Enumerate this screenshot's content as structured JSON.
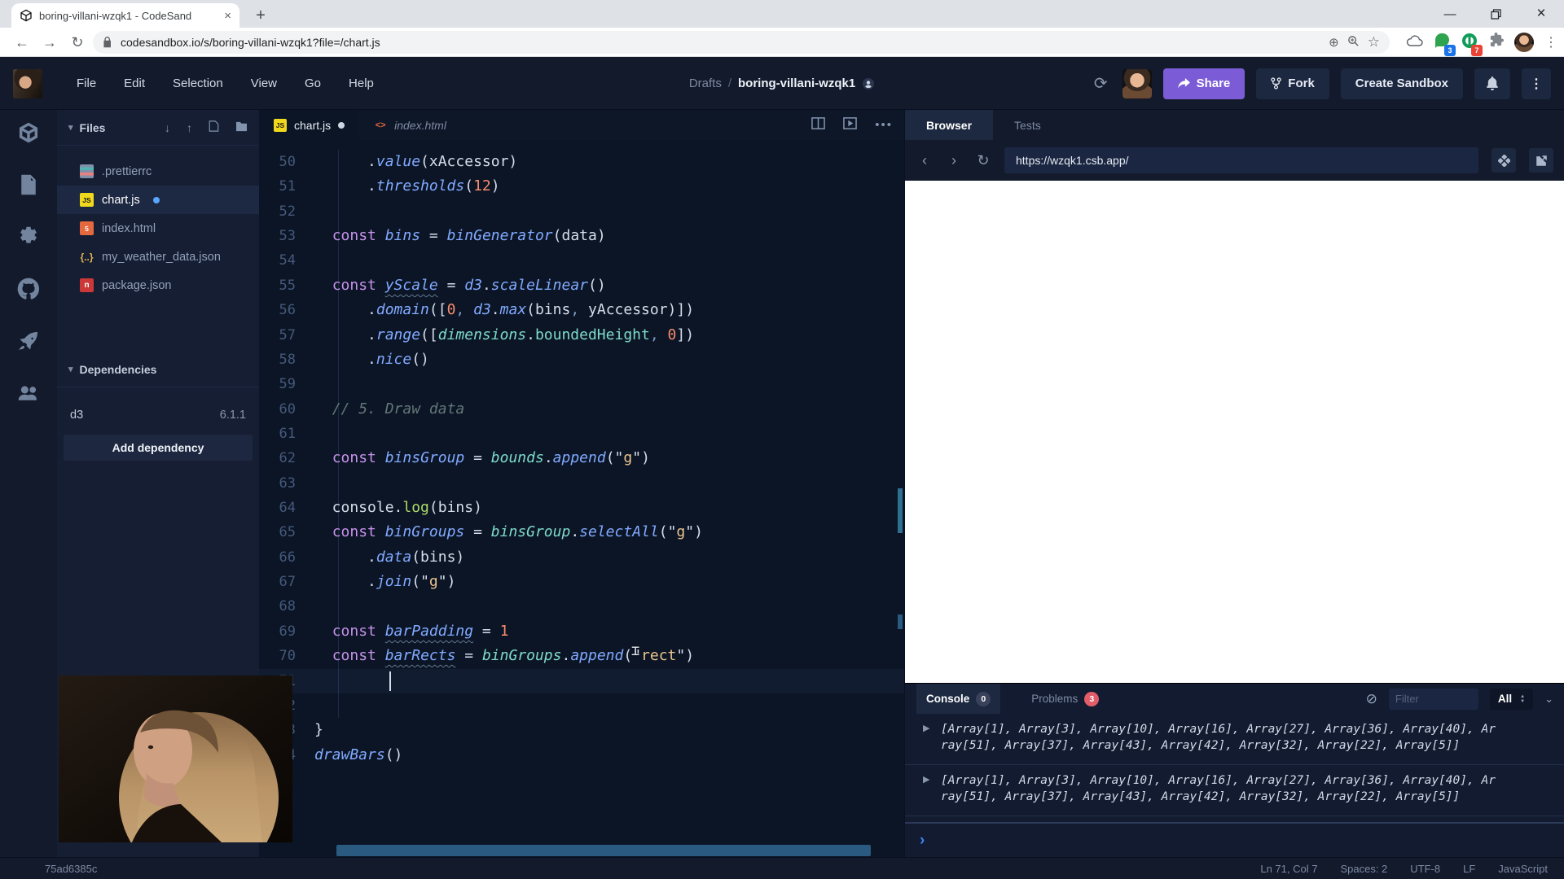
{
  "browser_chrome": {
    "tab_title": "boring-villani-wzqk1 - CodeSand",
    "close_tab_glyph": "×",
    "new_tab_glyph": "+",
    "back_glyph": "←",
    "forward_glyph": "→",
    "reload_glyph": "↻",
    "url": "codesandbox.io/s/boring-villani-wzqk1?file=/chart.js",
    "zoom_glyph": "⊕",
    "bookmark_glyph": "☆",
    "extension_chat_badge": "3",
    "extension_ring_badge": "7",
    "kebab_glyph": "⋮",
    "minimize_glyph": "—",
    "close_glyph": "×"
  },
  "header": {
    "menus": [
      "File",
      "Edit",
      "Selection",
      "View",
      "Go",
      "Help"
    ],
    "breadcrumb_prefix": "Drafts",
    "breadcrumb_sep": "/",
    "title": "boring-villani-wzqk1",
    "refresh_glyph": "⟳",
    "share_label": "Share",
    "fork_label": "Fork",
    "create_sandbox_label": "Create Sandbox",
    "accent_purple": "#7b5cd6"
  },
  "sidebar": {
    "files_header": "Files",
    "download_glyph": "↓",
    "upload_glyph": "↑",
    "files": [
      {
        "name": ".prettierrc",
        "icon": "prettier",
        "icon_text": "",
        "active": false,
        "modified": false
      },
      {
        "name": "chart.js",
        "icon": "js",
        "icon_text": "JS",
        "active": true,
        "modified": true
      },
      {
        "name": "index.html",
        "icon": "html",
        "icon_text": "5",
        "active": false,
        "modified": false
      },
      {
        "name": "my_weather_data.json",
        "icon": "json",
        "icon_text": "{..}",
        "active": false,
        "modified": false
      },
      {
        "name": "package.json",
        "icon": "npm",
        "icon_text": "n",
        "active": false,
        "modified": false
      }
    ],
    "dependencies_header": "Dependencies",
    "dependencies": [
      {
        "name": "d3",
        "version": "6.1.1"
      }
    ],
    "add_dependency_label": "Add dependency"
  },
  "editor": {
    "tabs": [
      {
        "label": "chart.js",
        "icon": "js",
        "icon_text": "JS",
        "active": true,
        "modified": true,
        "preview": false
      },
      {
        "label": "index.html",
        "icon": "html",
        "icon_text": "<>",
        "active": false,
        "modified": false,
        "preview": true
      }
    ],
    "cursor": {
      "line": 71,
      "col": 7
    },
    "first_line": 50,
    "lines": [
      {
        "n": 50,
        "tokens": [
          {
            "x": "      .",
            "c": "p"
          },
          {
            "x": "value",
            "c": "v"
          },
          {
            "x": "(xAccessor)",
            "c": "p"
          }
        ]
      },
      {
        "n": 51,
        "tokens": [
          {
            "x": "      .",
            "c": "p"
          },
          {
            "x": "thresholds",
            "c": "v"
          },
          {
            "x": "(",
            "c": "p"
          },
          {
            "x": "12",
            "c": "n"
          },
          {
            "x": ")",
            "c": "p"
          }
        ]
      },
      {
        "n": 52,
        "tokens": []
      },
      {
        "n": 53,
        "tokens": [
          {
            "x": "  ",
            "c": "p"
          },
          {
            "x": "const",
            "c": "k"
          },
          {
            "x": " ",
            "c": "p"
          },
          {
            "x": "bins",
            "c": "v"
          },
          {
            "x": " = ",
            "c": "p"
          },
          {
            "x": "binGenerator",
            "c": "v"
          },
          {
            "x": "(data)",
            "c": "p"
          }
        ]
      },
      {
        "n": 54,
        "tokens": []
      },
      {
        "n": 55,
        "tokens": [
          {
            "x": "  ",
            "c": "p"
          },
          {
            "x": "const",
            "c": "k"
          },
          {
            "x": " ",
            "c": "p"
          },
          {
            "x": "yScale",
            "c": "u"
          },
          {
            "x": " = ",
            "c": "p"
          },
          {
            "x": "d3",
            "c": "v"
          },
          {
            "x": ".",
            "c": "p"
          },
          {
            "x": "scaleLinear",
            "c": "v"
          },
          {
            "x": "()",
            "c": "p"
          }
        ]
      },
      {
        "n": 56,
        "tokens": [
          {
            "x": "      .",
            "c": "p"
          },
          {
            "x": "domain",
            "c": "v"
          },
          {
            "x": "([",
            "c": "p"
          },
          {
            "x": "0",
            "c": "n"
          },
          {
            "x": ",",
            "c": "d"
          },
          {
            "x": " ",
            "c": "p"
          },
          {
            "x": "d3",
            "c": "v"
          },
          {
            "x": ".",
            "c": "p"
          },
          {
            "x": "max",
            "c": "v"
          },
          {
            "x": "(bins",
            "c": "p"
          },
          {
            "x": ",",
            "c": "d"
          },
          {
            "x": " yAccessor)])",
            "c": "p"
          }
        ]
      },
      {
        "n": 57,
        "tokens": [
          {
            "x": "      .",
            "c": "p"
          },
          {
            "x": "range",
            "c": "v"
          },
          {
            "x": "([",
            "c": "p"
          },
          {
            "x": "dimensions",
            "c": "t"
          },
          {
            "x": ".",
            "c": "p"
          },
          {
            "x": "boundedHeight",
            "c": "t2"
          },
          {
            "x": ",",
            "c": "d"
          },
          {
            "x": " ",
            "c": "p"
          },
          {
            "x": "0",
            "c": "n"
          },
          {
            "x": "])",
            "c": "p"
          }
        ]
      },
      {
        "n": 58,
        "tokens": [
          {
            "x": "      .",
            "c": "p"
          },
          {
            "x": "nice",
            "c": "v"
          },
          {
            "x": "()",
            "c": "p"
          }
        ]
      },
      {
        "n": 59,
        "tokens": []
      },
      {
        "n": 60,
        "tokens": [
          {
            "x": "  ",
            "c": "p"
          },
          {
            "x": "// 5. Draw data",
            "c": "cm"
          }
        ]
      },
      {
        "n": 61,
        "tokens": []
      },
      {
        "n": 62,
        "tokens": [
          {
            "x": "  ",
            "c": "p"
          },
          {
            "x": "const",
            "c": "k"
          },
          {
            "x": " ",
            "c": "p"
          },
          {
            "x": "binsGroup",
            "c": "v"
          },
          {
            "x": " = ",
            "c": "p"
          },
          {
            "x": "bounds",
            "c": "t"
          },
          {
            "x": ".",
            "c": "p"
          },
          {
            "x": "append",
            "c": "v"
          },
          {
            "x": "(",
            "c": "p"
          },
          {
            "x": "\"",
            "c": "q"
          },
          {
            "x": "g",
            "c": "s"
          },
          {
            "x": "\"",
            "c": "q"
          },
          {
            "x": ")",
            "c": "p"
          }
        ]
      },
      {
        "n": 63,
        "tokens": []
      },
      {
        "n": 64,
        "tokens": [
          {
            "x": "  console.",
            "c": "p"
          },
          {
            "x": "log",
            "c": "gr"
          },
          {
            "x": "(bins)",
            "c": "p"
          }
        ]
      },
      {
        "n": 65,
        "tokens": [
          {
            "x": "  ",
            "c": "p"
          },
          {
            "x": "const",
            "c": "k"
          },
          {
            "x": " ",
            "c": "p"
          },
          {
            "x": "binGroups",
            "c": "v"
          },
          {
            "x": " = ",
            "c": "p"
          },
          {
            "x": "binsGroup",
            "c": "t"
          },
          {
            "x": ".",
            "c": "p"
          },
          {
            "x": "selectAll",
            "c": "v"
          },
          {
            "x": "(",
            "c": "p"
          },
          {
            "x": "\"",
            "c": "q"
          },
          {
            "x": "g",
            "c": "s"
          },
          {
            "x": "\"",
            "c": "q"
          },
          {
            "x": ")",
            "c": "p"
          }
        ]
      },
      {
        "n": 66,
        "tokens": [
          {
            "x": "      .",
            "c": "p"
          },
          {
            "x": "data",
            "c": "v"
          },
          {
            "x": "(bins)",
            "c": "p"
          }
        ]
      },
      {
        "n": 67,
        "tokens": [
          {
            "x": "      .",
            "c": "p"
          },
          {
            "x": "join",
            "c": "v"
          },
          {
            "x": "(",
            "c": "p"
          },
          {
            "x": "\"",
            "c": "q"
          },
          {
            "x": "g",
            "c": "s"
          },
          {
            "x": "\"",
            "c": "q"
          },
          {
            "x": ")",
            "c": "p"
          }
        ]
      },
      {
        "n": 68,
        "tokens": []
      },
      {
        "n": 69,
        "tokens": [
          {
            "x": "  ",
            "c": "p"
          },
          {
            "x": "const",
            "c": "k"
          },
          {
            "x": " ",
            "c": "p"
          },
          {
            "x": "barPadding",
            "c": "u"
          },
          {
            "x": " = ",
            "c": "p"
          },
          {
            "x": "1",
            "c": "n"
          }
        ]
      },
      {
        "n": 70,
        "tokens": [
          {
            "x": "  ",
            "c": "p"
          },
          {
            "x": "const",
            "c": "k"
          },
          {
            "x": " ",
            "c": "p"
          },
          {
            "x": "barRects",
            "c": "u"
          },
          {
            "x": " = ",
            "c": "p"
          },
          {
            "x": "binGroups",
            "c": "t"
          },
          {
            "x": ".",
            "c": "p"
          },
          {
            "x": "append",
            "c": "v"
          },
          {
            "x": "(",
            "c": "p"
          },
          {
            "x": "\"",
            "c": "q"
          },
          {
            "x": "rect",
            "c": "s"
          },
          {
            "x": "\"",
            "c": "q"
          },
          {
            "x": ")",
            "c": "p"
          }
        ]
      },
      {
        "n": 71,
        "tokens": []
      },
      {
        "n": 72,
        "tokens": []
      },
      {
        "n": 73,
        "tokens": [
          {
            "x": "}",
            "c": "p"
          }
        ]
      },
      {
        "n": 74,
        "tokens": [
          {
            "x": "drawBars",
            "c": "v"
          },
          {
            "x": "()",
            "c": "p"
          }
        ]
      }
    ]
  },
  "preview": {
    "tabs": [
      {
        "label": "Browser",
        "active": true
      },
      {
        "label": "Tests",
        "active": false
      }
    ],
    "back_glyph": "‹",
    "forward_glyph": "›",
    "reload_glyph": "↻",
    "url": "https://wzqk1.csb.app/"
  },
  "console": {
    "title": "Console",
    "console_badge": "0",
    "problems_label": "Problems",
    "problems_badge": "3",
    "clear_glyph": "⊘",
    "filter_placeholder": "Filter",
    "level_selected": "All",
    "collapse_glyph": "⌄",
    "entry_glyph": "▶",
    "prompt_glyph": "›",
    "entries": [
      "[Array[1], Array[3], Array[10], Array[16], Array[27], Array[36], Array[40], Array[51], Array[37], Array[43], Array[42], Array[32], Array[22], Array[5]]",
      "[Array[1], Array[3], Array[10], Array[16], Array[27], Array[36], Array[40], Array[51], Array[37], Array[43], Array[42], Array[32], Array[22], Array[5]]"
    ]
  },
  "status_bar": {
    "left": "75ad6385c",
    "right_items": [
      "Ln 71, Col 7",
      "Spaces: 2",
      "UTF-8",
      "LF",
      "JavaScript"
    ]
  }
}
